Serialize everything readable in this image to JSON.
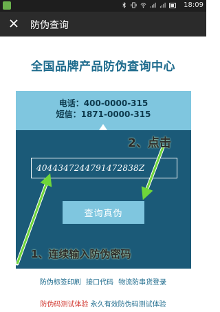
{
  "status_bar": {
    "time": "18:09",
    "icons": [
      "bluetooth-icon",
      "vibrate-icon",
      "wifi-icon",
      "signal-icon",
      "signal-icon",
      "battery-icon"
    ]
  },
  "title_bar": {
    "close_icon": "close-icon",
    "title": "防伪查询"
  },
  "main": {
    "heading": "全国品牌产品防伪查询中心",
    "contact": {
      "phone": "电话：400-0000-315",
      "sms": "短信：1871-0000-315"
    },
    "code_input": {
      "value": "4044347244791472838Z"
    },
    "query_button": "查询真伪",
    "annotation_click": "2、点击",
    "annotation_input": "1、连续输入防伪密码"
  },
  "links_row1": [
    "防伪标签印刷",
    "接口代码",
    "物流防串货登录"
  ],
  "links_row2": {
    "red": "防伪码测试体验",
    "blue": "永久有效防伪码测试体验"
  },
  "colors": {
    "heading": "#1c6a8c",
    "panel": "#1b5a78",
    "light_blue": "#7fc6df",
    "annotation_green": "#6fd63a",
    "red_link": "#d0342c"
  }
}
